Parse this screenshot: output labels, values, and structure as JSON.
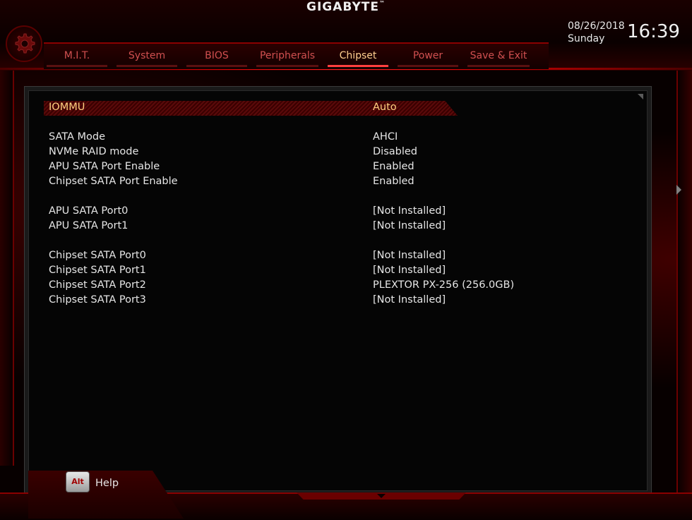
{
  "brand": {
    "name": "GIGABYTE",
    "tm": "™"
  },
  "colors": {
    "accent": "#d40000",
    "highlight_text": "#ffd080",
    "tab_inactive": "#d05050"
  },
  "tabs": [
    {
      "label": "M.I.T."
    },
    {
      "label": "System"
    },
    {
      "label": "BIOS"
    },
    {
      "label": "Peripherals"
    },
    {
      "label": "Chipset",
      "active": true
    },
    {
      "label": "Power"
    },
    {
      "label": "Save & Exit"
    }
  ],
  "datetime": {
    "date": "08/26/2018",
    "day": "Sunday",
    "time": "16:39"
  },
  "settings": [
    {
      "label": "IOMMU",
      "value": "Auto"
    },
    {
      "label": "SATA Mode",
      "value": "AHCI"
    },
    {
      "label": "NVMe RAID mode",
      "value": "Disabled"
    },
    {
      "label": "APU SATA Port Enable",
      "value": "Enabled"
    },
    {
      "label": "Chipset SATA Port Enable",
      "value": "Enabled"
    },
    {
      "label": "APU SATA Port0",
      "value": "[Not Installed]"
    },
    {
      "label": "APU SATA Port1",
      "value": "[Not Installed]"
    },
    {
      "label": "Chipset SATA Port0",
      "value": "[Not Installed]"
    },
    {
      "label": "Chipset SATA Port1",
      "value": "[Not Installed]"
    },
    {
      "label": "Chipset SATA Port2",
      "value": "PLEXTOR PX-256 (256.0GB)"
    },
    {
      "label": "Chipset SATA Port3",
      "value": "[Not Installed]"
    }
  ],
  "footer": {
    "key": "Alt",
    "label": "Help"
  },
  "icons": {
    "settings": "gear-icon",
    "scroll": "arrow-right-icon",
    "bottom": "arrow-down-icon"
  }
}
